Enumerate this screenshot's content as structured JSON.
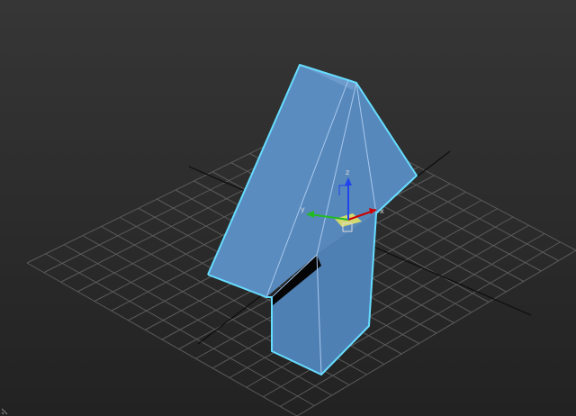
{
  "viewport": {
    "background_top": "#363636",
    "background_bottom": "#222222",
    "grid_color": "#5a5a5a",
    "grid_axis_color": "#0d0d0d",
    "object_fill": "#5a8cc0",
    "object_shade": "#4a7aae",
    "object_dark": "#3d6a9c",
    "selection_edge_color": "#66ddff",
    "inner_edge_color": "#a8c8ec"
  },
  "gizmo": {
    "x_label": "x",
    "y_label": "y",
    "z_label": "z",
    "x_color": "#cc0000",
    "y_color": "#22bb22",
    "z_color": "#2244ee",
    "plane_color": "#e8e860"
  },
  "icons": {
    "transform_gizmo": "move-gizmo-icon",
    "corner_handle": "resize-corner-icon"
  }
}
